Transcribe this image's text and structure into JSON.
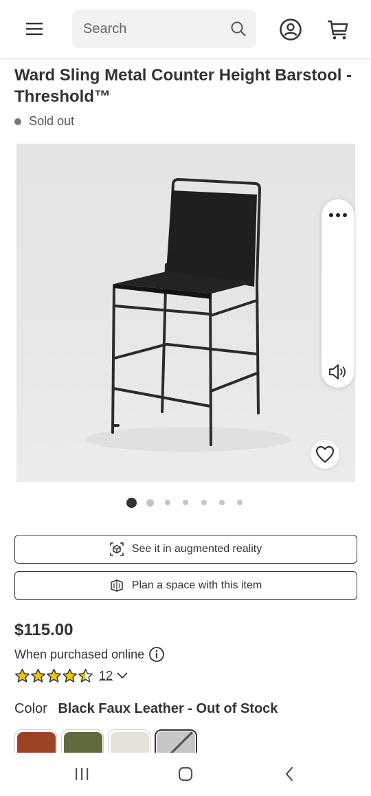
{
  "header": {
    "search_placeholder": "Search",
    "icons": [
      "menu-icon",
      "search-icon",
      "account-icon",
      "cart-icon"
    ]
  },
  "product": {
    "title": "Ward Sling Metal Counter Height Barstool - Threshold™",
    "status": "Sold out",
    "price": "$115.00",
    "purchase_note": "When purchased online",
    "rating": 4.5,
    "review_count": "12",
    "color_label": "Color",
    "color_value": "Black Faux Leather - Out of Stock"
  },
  "gallery": {
    "image_count": 7,
    "active_index": 0
  },
  "actions": {
    "ar_label": "See it in augmented reality",
    "plan_label": "Plan a space with this item"
  },
  "swatches": [
    {
      "color": "#9c4326",
      "selected": false
    },
    {
      "color": "#5f6b3c",
      "selected": false
    },
    {
      "color": "#e6e2da",
      "selected": false
    },
    {
      "color": "#c6c6c6",
      "selected": true
    }
  ],
  "colors": {
    "text": "#333333",
    "dot_active": "#333333",
    "dot_inactive": "#c4c4c4",
    "star": "#f2c10c"
  }
}
